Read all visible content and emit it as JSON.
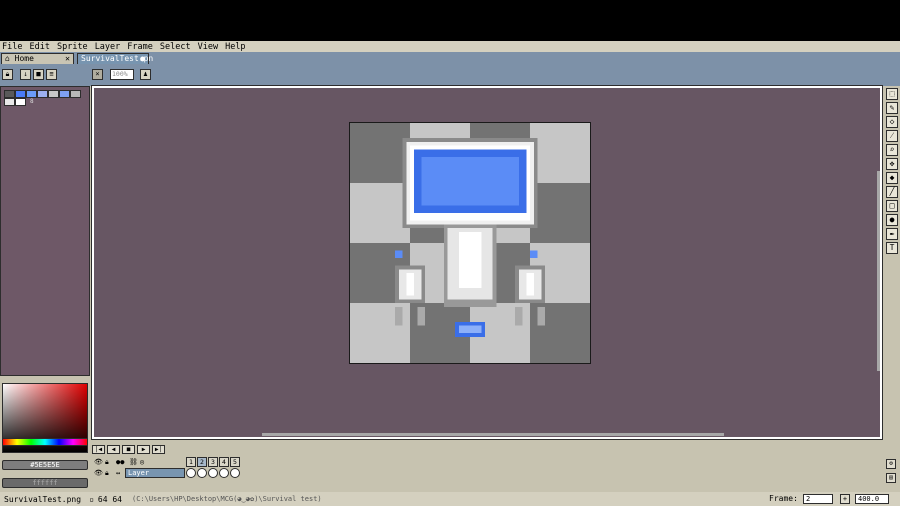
{
  "menu": [
    "File",
    "Edit",
    "Sprite",
    "Layer",
    "Frame",
    "Select",
    "View",
    "Help"
  ],
  "tabs": {
    "home": "Home",
    "home_close": "✕",
    "file": "SurvivalTest.pn"
  },
  "toolbar": {
    "zoom_value": "100%"
  },
  "palette": {
    "colors": [
      "#5a5a5a",
      "#4a7cf5",
      "#6a9cf8",
      "#9cb0f0",
      "#c8c8c8",
      "#7ea0f2",
      "#b8b8b8",
      "#e8e8e8",
      "#ffffff"
    ],
    "index_label": "8"
  },
  "color_fields": {
    "hex": "#5E5E5E",
    "secondary": "ffffff"
  },
  "timeline": {
    "layer_name": "Layer",
    "frames": [
      "1",
      "2",
      "3",
      "4",
      "5"
    ],
    "active_frame": 1
  },
  "status": {
    "filename": "SurvivalTest.png",
    "size": "64 64",
    "path": "(C:\\Users\\HP\\Desktop\\MCG(◕‿◕✿)\\Survival test)",
    "frame_label": "Frame:",
    "frame_value": "2",
    "zoom_value": "400.0"
  },
  "colors": {
    "canvas_bg": "#675663",
    "accent_blue": "#4a7cf5",
    "chrome": "#c7c3b0"
  }
}
